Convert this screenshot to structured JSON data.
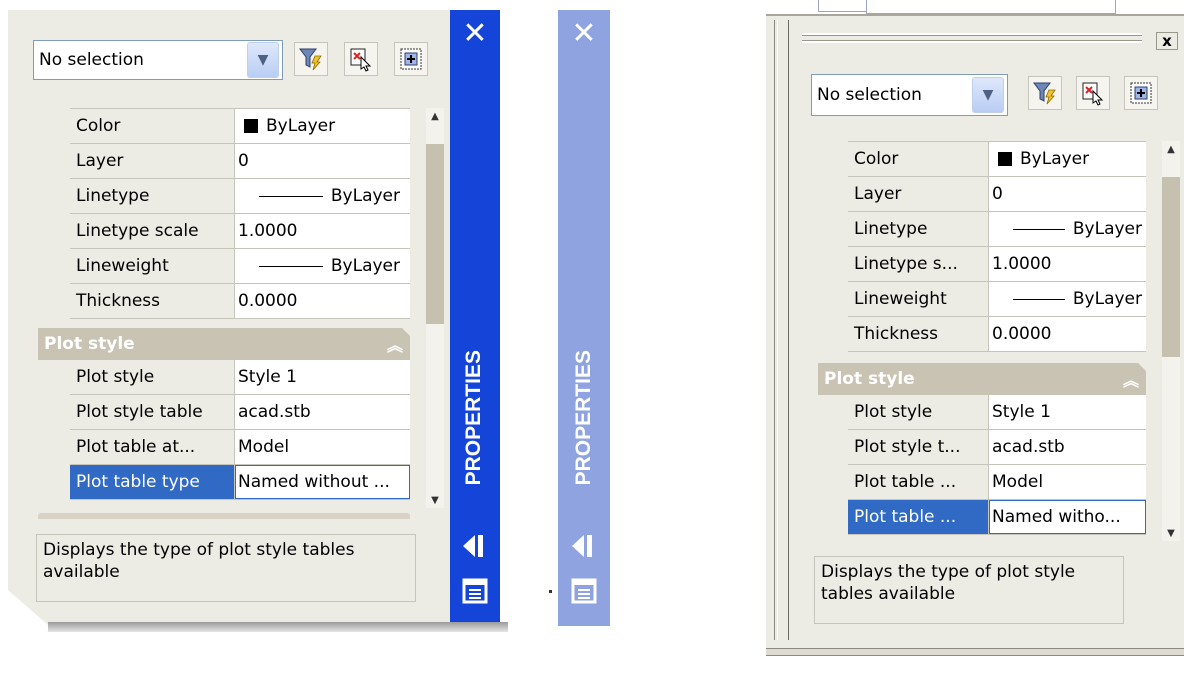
{
  "panel_a": {
    "selection": "No selection",
    "close_glyph": "✕",
    "vertical_title": "PROPERTIES",
    "rows": [
      {
        "label": "Color",
        "value": "ByLayer",
        "kind": "color"
      },
      {
        "label": "Layer",
        "value": "0",
        "kind": "text"
      },
      {
        "label": "Linetype",
        "value": "ByLayer",
        "kind": "line"
      },
      {
        "label": "Linetype scale",
        "value": "1.0000",
        "kind": "text"
      },
      {
        "label": "Lineweight",
        "value": "ByLayer",
        "kind": "line"
      },
      {
        "label": "Thickness",
        "value": "0.0000",
        "kind": "text"
      }
    ],
    "section_title": "Plot style",
    "section_rows": [
      {
        "label": "Plot style",
        "value": "Style 1"
      },
      {
        "label": "Plot style table",
        "value": "acad.stb"
      },
      {
        "label": "Plot table at...",
        "value": "Model"
      },
      {
        "label": "Plot table type",
        "value": "Named without ..."
      }
    ],
    "description": "Displays the type of plot style tables available"
  },
  "panel_b": {
    "close_glyph": "✕",
    "vertical_title": "PROPERTIES"
  },
  "panel_c": {
    "close_glyph": "x",
    "selection": "No selection",
    "rows": [
      {
        "label": "Color",
        "value": "ByLayer",
        "kind": "color"
      },
      {
        "label": "Layer",
        "value": "0",
        "kind": "text"
      },
      {
        "label": "Linetype",
        "value": "ByLayer",
        "kind": "line"
      },
      {
        "label": "Linetype s...",
        "value": "1.0000",
        "kind": "text"
      },
      {
        "label": "Lineweight",
        "value": "ByLayer",
        "kind": "line"
      },
      {
        "label": "Thickness",
        "value": "0.0000",
        "kind": "text"
      }
    ],
    "section_title": "Plot style",
    "section_rows": [
      {
        "label": "Plot style",
        "value": "Style 1"
      },
      {
        "label": "Plot style t...",
        "value": "acad.stb"
      },
      {
        "label": "Plot table ...",
        "value": "Model"
      },
      {
        "label": "Plot table ...",
        "value": "Named witho..."
      }
    ],
    "description_line1": "Displays the type of plot style",
    "description_line2": "tables available"
  },
  "icons": [
    "chevron-down-icon",
    "quick-select-filter-icon",
    "select-objects-icon",
    "toggle-pickadd-icon",
    "close-icon",
    "auto-hide-icon",
    "properties-menu-icon",
    "collapse-section-icon",
    "scroll-up-icon",
    "scroll-down-icon"
  ],
  "colors": {
    "caption_blue": "#1444d8",
    "caption_blue_faded": "#8ea3e0",
    "selection_blue": "#316ac5",
    "section_header": "#c9c3b3",
    "panel_bg": "#ecebe4"
  }
}
